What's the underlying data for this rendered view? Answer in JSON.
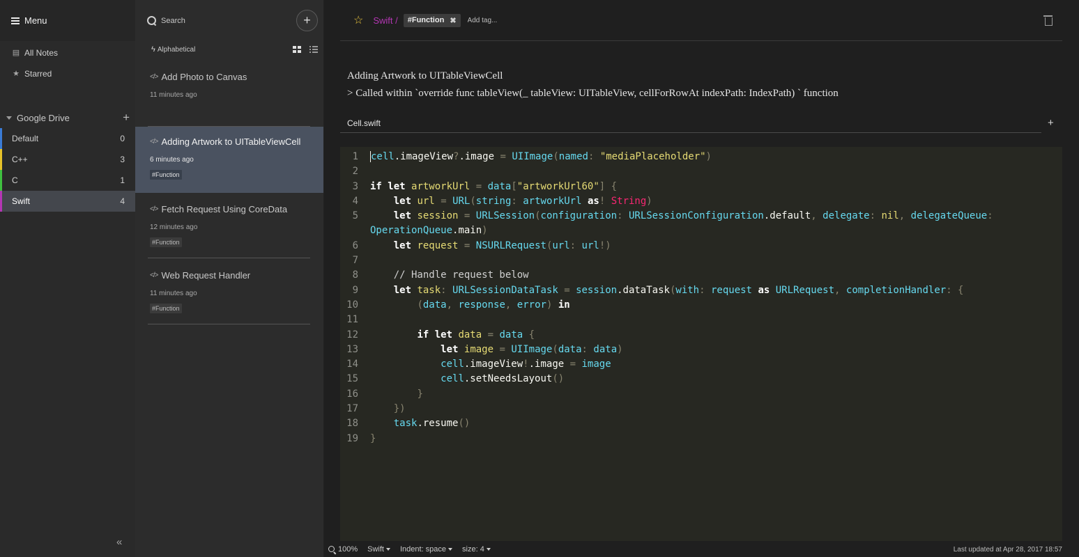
{
  "sidenav": {
    "menu_label": "Menu",
    "all_notes": "All Notes",
    "starred": "Starred",
    "storage_name": "Google Drive",
    "folders": [
      {
        "name": "Default",
        "count": "0",
        "color": "#3a7bd5"
      },
      {
        "name": "C++",
        "count": "3",
        "color": "#e6c229"
      },
      {
        "name": "C",
        "count": "1",
        "color": "#3fbf3f"
      },
      {
        "name": "Swift",
        "count": "4",
        "color": "#b436b4"
      }
    ],
    "active_folder": "Swift"
  },
  "notelist": {
    "search_placeholder": "Search",
    "sort_label": "Alphabetical",
    "notes": [
      {
        "title": "Add Photo to Canvas",
        "time": "11 minutes ago",
        "tag": ""
      },
      {
        "title": "Adding Artwork to UITableViewCell",
        "time": "6 minutes ago",
        "tag": "#Function"
      },
      {
        "title": "Fetch Request Using CoreData",
        "time": "12 minutes ago",
        "tag": "#Function"
      },
      {
        "title": "Web Request Handler",
        "time": "11 minutes ago",
        "tag": "#Function"
      }
    ]
  },
  "editor": {
    "folder_crumb": "Swift /",
    "tag": "#Function",
    "add_tag_placeholder": "Add tag...",
    "description_line1": "Adding Artwork to UITableViewCell",
    "description_line2": "> Called within `override func tableView(_ tableView: UITableView, cellForRowAt indexPath: IndexPath) ` function",
    "file_name": "Cell.swift",
    "accent_color": "#b436b4",
    "code_lines": [
      "cell.imageView?.image = UIImage(named: \"mediaPlaceholder\")",
      "",
      "if let artworkUrl = data[\"artworkUrl60\"] {",
      "    let url = URL(string: artworkUrl as! String)",
      "    let session = URLSession(configuration: URLSessionConfiguration.default, delegate: nil, delegateQueue:",
      "OperationQueue.main)",
      "    let request = NSURLRequest(url: url!)",
      "",
      "    // Handle request below",
      "    let task: URLSessionDataTask = session.dataTask(with: request as URLRequest, completionHandler: {",
      "        (data, response, error) in",
      "",
      "        if let data = data {",
      "            let image = UIImage(data: data)",
      "            cell.imageView!.image = image",
      "            cell.setNeedsLayout()",
      "        }",
      "    })",
      "    task.resume()",
      "}"
    ],
    "line_numbers": [
      "1",
      "2",
      "3",
      "4",
      "5",
      "",
      "6",
      "7",
      "8",
      "9",
      "10",
      "11",
      "12",
      "13",
      "14",
      "15",
      "16",
      "17",
      "18",
      "19"
    ]
  },
  "statusbar": {
    "zoom": "100%",
    "mode": "Swift",
    "indent": "Indent: space",
    "size": "size: 4",
    "last_updated": "Last updated at Apr 28, 2017 18:57"
  },
  "icons": {
    "menu": "hamburger-icon",
    "all_notes": "archive-icon",
    "starred": "star-icon",
    "search": "search-icon",
    "new_note": "plus-icon",
    "note": "code-icon",
    "favorite": "star-outline-icon",
    "trash": "trash-icon",
    "collapse": "double-chevron-left-icon"
  }
}
